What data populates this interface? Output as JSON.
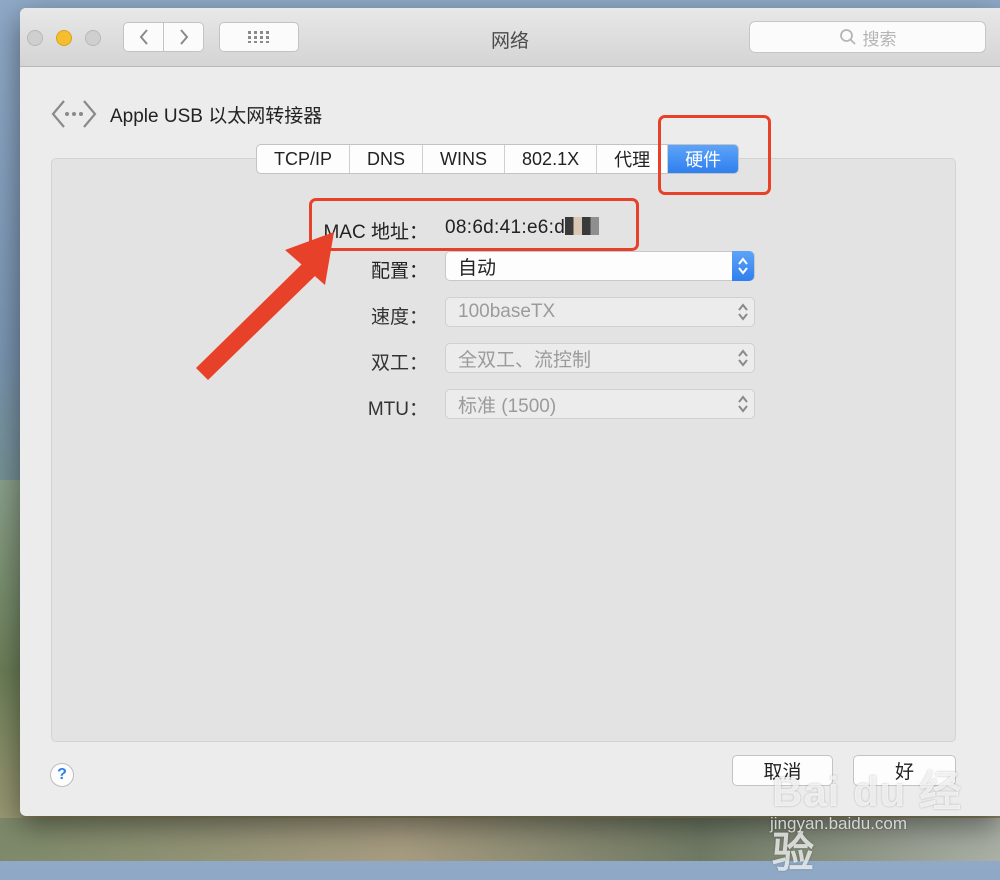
{
  "window": {
    "title": "网络"
  },
  "search": {
    "placeholder": "搜索"
  },
  "adapter": {
    "name": "Apple USB 以太网转接器"
  },
  "tabs": [
    {
      "label": "TCP/IP",
      "active": false
    },
    {
      "label": "DNS",
      "active": false
    },
    {
      "label": "WINS",
      "active": false
    },
    {
      "label": "802.1X",
      "active": false
    },
    {
      "label": "代理",
      "active": false
    },
    {
      "label": "硬件",
      "active": true
    }
  ],
  "hardware": {
    "mac_label": "MAC 地址：",
    "mac_value": "08:6d:41:e6:d",
    "config_label": "配置：",
    "config_value": "自动",
    "speed_label": "速度：",
    "speed_value": "100baseTX",
    "duplex_label": "双工：",
    "duplex_value": "全双工、流控制",
    "mtu_label": "MTU：",
    "mtu_value": "标准 (1500)"
  },
  "footer": {
    "help_label": "?",
    "cancel_label": "取消",
    "ok_label": "好"
  },
  "watermark": {
    "logo": "Bai du 经验",
    "url": "jingyan.baidu.com"
  },
  "colors": {
    "accent": "#2f7fef",
    "annotation": "#e8412a"
  }
}
